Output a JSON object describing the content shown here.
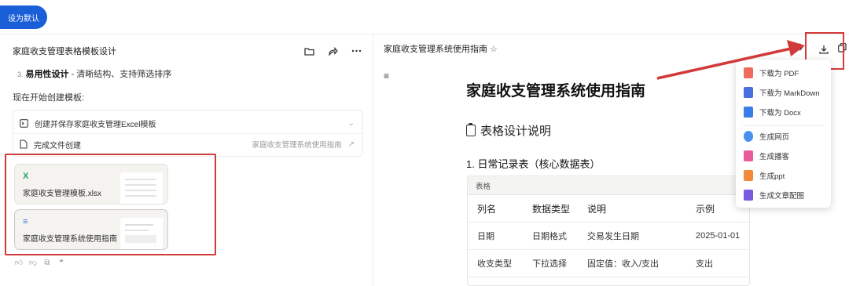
{
  "topbar": {
    "set_default": "设为默认"
  },
  "left": {
    "title": "家庭收支管理表格模板设计",
    "point_num": "3.",
    "point_bold": "易用性设计",
    "point_rest": " - 清晰结构、支持筛选排序",
    "intro": "现在开始创建模板:",
    "tasks": [
      {
        "label": "创建并保存家庭收支管理Excel模板"
      },
      {
        "label": "完成文件创建",
        "link": "家庭收支管理系统使用指南"
      }
    ],
    "cards": [
      {
        "icon": "X",
        "name": "家庭收支管理模板.xlsx"
      },
      {
        "icon": "≡",
        "name": "家庭收支管理系统使用指南"
      }
    ]
  },
  "right": {
    "title": "家庭收支管理系统使用指南",
    "star": "☆",
    "doc_title": "家庭收支管理系统使用指南",
    "section": "表格设计说明",
    "subsection": "1. 日常记录表（核心数据表）",
    "table_bar": "表格",
    "table_head": [
      "列名",
      "数据类型",
      "说明",
      "示例"
    ],
    "table_rows": [
      [
        "日期",
        "日期格式",
        "交易发生日期",
        "2025-01-01"
      ],
      [
        "收支类型",
        "下拉选择",
        "固定值：收入/支出",
        "支出"
      ]
    ]
  },
  "dropdown": {
    "items": [
      {
        "label": "下载为 PDF",
        "color": "#f06a5f"
      },
      {
        "label": "下载为 MarkDown",
        "color": "#4a6fe0"
      },
      {
        "label": "下载为 Docx",
        "color": "#3b7ce8"
      },
      {
        "label": "生成网页",
        "color": "#4a8ff0"
      },
      {
        "label": "生成播客",
        "color": "#e85a9b"
      },
      {
        "label": "生成ppt",
        "color": "#f28a3a"
      },
      {
        "label": "生成文章配图",
        "color": "#7a5ae0"
      }
    ]
  },
  "colors": {
    "accent": "#1a5fd8",
    "highlight": "#d23a3a"
  }
}
